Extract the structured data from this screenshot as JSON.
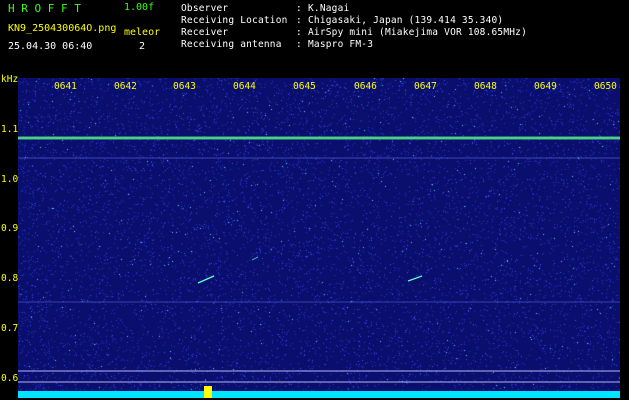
{
  "header": {
    "title": "H R O F F T",
    "version": "1.00f",
    "filename": "KN9_250430064O.png",
    "datetime": "25.04.30 06:40",
    "type_label": "meleor",
    "count": "2"
  },
  "info": {
    "observer_label": "Observer",
    "observer_value": "K.Nagai",
    "location_label": "Receiving Location",
    "location_value": "Chigasaki, Japan (139.414 35.340)",
    "receiver_label": "Receiver",
    "receiver_value": "AirSpy mini (Miakejima VOR 108.65MHz)",
    "antenna_label": "Receiving antenna",
    "antenna_value": "Maspro FM-3",
    "colon": ":"
  },
  "axis": {
    "unit": "kHz",
    "y_ticks": [
      "1.1",
      "1.0",
      "0.9",
      "0.8",
      "0.7",
      "0.6"
    ],
    "time_ticks": [
      "0641",
      "0642",
      "0643",
      "0644",
      "0645",
      "0646",
      "0647",
      "0648",
      "0649",
      "0650"
    ]
  },
  "colors": {
    "background": "#0a0f6e",
    "carrier": "#2ee86a",
    "axis_text": "#ffff00",
    "title_green": "#39ff14",
    "baseline": "#00e5ff"
  }
}
